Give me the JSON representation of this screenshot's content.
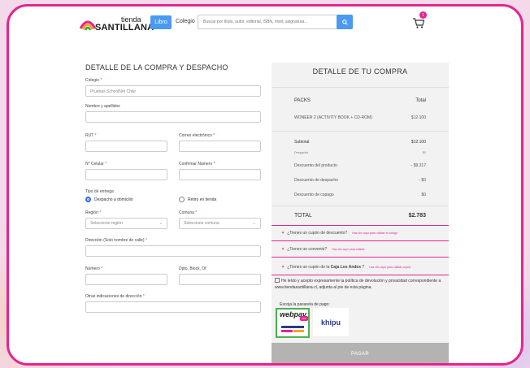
{
  "header": {
    "logo_small": "tienda",
    "logo_big": "SANTILLANA",
    "libro_label": "Libro",
    "colegio_label": "Colegio",
    "search_placeholder": "Buscar por título, autor, editorial, ISBN, nivel, asignatura...",
    "cart_count": "1"
  },
  "form": {
    "title": "DETALLE DE LA COMPRA Y DESPACHO",
    "colegio_label": "Colegio",
    "colegio_value": "Pruebas SchoolNet Chile",
    "nombre_label": "Nombre y apellidos",
    "rut_label": "RUT",
    "correo_label": "Correo electrónico",
    "celular_label": "N° Celular",
    "confirmar_label": "Confirmar Número",
    "tipo_entrega_label": "Tipo de entrega",
    "entrega_opt1": "Despacho a domicilio",
    "entrega_opt2": "Retiro en tienda",
    "region_label": "Región",
    "region_placeholder": "Seleccione región",
    "comuna_label": "Comuna",
    "comuna_placeholder": "Seleccione comuna",
    "direccion_label": "Dirección (Solo nombre de calle)",
    "numero_label": "Número",
    "depto_label": "Dpto, Block, Of",
    "otras_label": "Otras indicaciones de dirección",
    "required_mark": "*",
    "chevron": "⌄"
  },
  "summary": {
    "title": "DETALLE DE TU COMPRA",
    "col_packs": "PACKS",
    "col_total": "Total",
    "item_name": "WONEER 2 (ACTIVITY BOOK + CD-ROM)",
    "item_price": "$12.100",
    "subtotal_label": "Subtotal",
    "subtotal_value": "$12.100",
    "despacho_label": "Despacho",
    "despacho_value": "$0",
    "desc_producto_label": "Descuento del producto",
    "desc_producto_value": "- $9.317",
    "desc_despacho_label": "Descuento de despacho",
    "desc_despacho_value": "- $0",
    "desc_copago_label": "Descuento de copago",
    "desc_copago_value": "$0",
    "total_label": "TOTAL",
    "total_value": "$2.783",
    "coupon1_text": "¿Tienes un cupón de descuento?",
    "coupon1_hint": "Haz clic aquí para validar el código",
    "coupon2_text": "¿Tienes un convenio?",
    "coupon2_hint": "Haz clic aquí para validar",
    "coupon3_pre": "¿Tienes un cupón de la ",
    "coupon3_bold": "Caja Los Andes",
    "coupon3_post": " ?",
    "coupon3_hint": "Haz clic aquí para validar cupón",
    "terms_text": "He leído y acepto expresamente la política de devolución y privacidad correspondiente a www.tiendasantillana.cl, adjunta al pie de esta página.",
    "pay_label": "Escoja la pasarela de pago:",
    "webpay_label": "webpay",
    "webpay_sub": "plus",
    "khipu_label": "khipu",
    "pay_button": "PAGAR",
    "tag_icon": "✦"
  },
  "colors": {
    "accent": "#e5248f",
    "blue": "#4a9af2",
    "pay_button": "#b5b2b2"
  }
}
